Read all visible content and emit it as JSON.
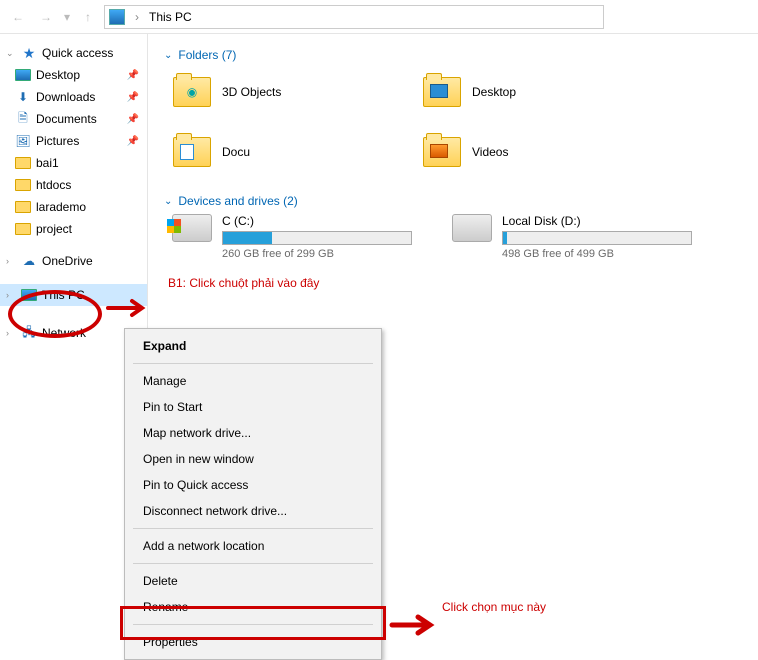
{
  "addressbar": {
    "location": "This PC"
  },
  "sidebar": {
    "quick_access": "Quick access",
    "desktop": "Desktop",
    "downloads": "Downloads",
    "documents": "Documents",
    "pictures": "Pictures",
    "bai1": "bai1",
    "htdocs": "htdocs",
    "larademo": "larademo",
    "project": "project",
    "onedrive": "OneDrive",
    "this_pc": "This PC",
    "network": "Network"
  },
  "sections": {
    "folders_head": "Folders (7)",
    "drives_head": "Devices and drives (2)"
  },
  "folders": {
    "obj3d": "3D Objects",
    "desktop": "Desktop",
    "docu": "Docu",
    "videos": "Videos"
  },
  "drives": {
    "c": {
      "name": "C (C:)",
      "free": "260 GB free of 299 GB",
      "fill_pct": 26
    },
    "d": {
      "name": "Local Disk (D:)",
      "free": "498 GB free of 499 GB",
      "fill_pct": 2
    }
  },
  "context_menu": {
    "expand": "Expand",
    "manage": "Manage",
    "pin_start": "Pin to Start",
    "map_drive": "Map network drive...",
    "open_new": "Open in new window",
    "pin_quick": "Pin to Quick access",
    "disconnect": "Disconnect network drive...",
    "add_loc": "Add a network location",
    "delete": "Delete",
    "rename": "Rename",
    "properties": "Properties"
  },
  "annotations": {
    "b1": "B1: Click chuột phải vào đây",
    "b2": "Click chọn mục này"
  }
}
